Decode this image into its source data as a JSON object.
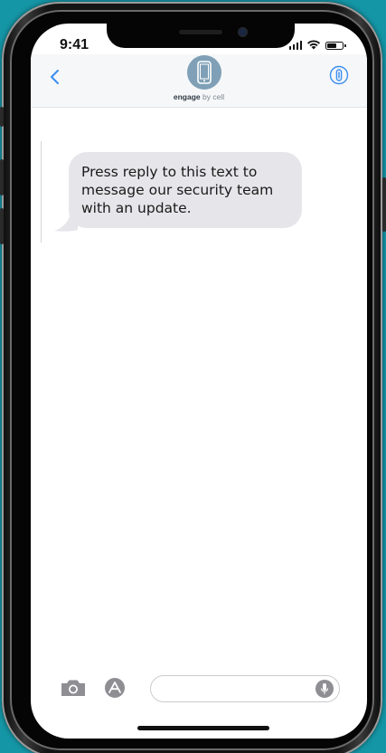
{
  "status_bar": {
    "time": "9:41"
  },
  "header": {
    "contact_brand": "engage",
    "contact_suffix": "by cell",
    "back_icon": "chevron-left-icon",
    "info_icon": "info-icon",
    "avatar_icon": "phone-icon"
  },
  "conversation": {
    "messages": [
      {
        "direction": "incoming",
        "text": "Press reply to this text to message our security team with an update."
      }
    ]
  },
  "compose": {
    "placeholder": "",
    "value": ""
  },
  "colors": {
    "background": "#1496a6",
    "accent_blue": "#3a8ef0",
    "bubble_incoming": "#e6e6ea",
    "avatar": "#7fa0b6"
  }
}
